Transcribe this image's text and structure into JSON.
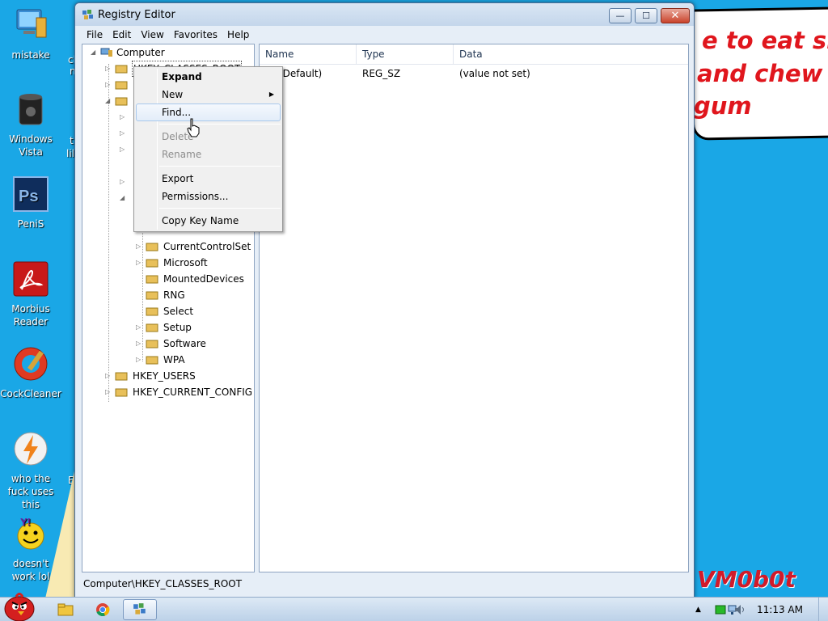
{
  "desktop": {
    "icons": [
      {
        "label": "mistake"
      },
      {
        "label": "Windows Vista"
      },
      {
        "label": "PeniS"
      },
      {
        "label": "Morbius Reader"
      },
      {
        "label": "CockCleaner"
      },
      {
        "label": "who the fuck uses this"
      },
      {
        "label": "doesn't work lol"
      }
    ],
    "partial_labels": [
      "cl",
      "n",
      "t",
      "lil",
      "E",
      "n"
    ],
    "wallpaper_text": [
      "e to eat shit",
      "and chew",
      "gum"
    ],
    "watermark": "VM0b0t"
  },
  "window": {
    "title": "Registry Editor",
    "menu": [
      "File",
      "Edit",
      "View",
      "Favorites",
      "Help"
    ],
    "controls": {
      "minimize": "—",
      "maximize": "☐",
      "close": "✕"
    }
  },
  "tree": {
    "root": "Computer",
    "hives_top": [
      "HKEY_CLASSES_ROOT"
    ],
    "system_children": [
      "CurrentControlSet",
      "Microsoft",
      "MountedDevices",
      "RNG",
      "Select",
      "Setup",
      "Software",
      "WPA"
    ],
    "hives_bottom": [
      "HKEY_USERS",
      "HKEY_CURRENT_CONFIG"
    ]
  },
  "list": {
    "columns": [
      "Name",
      "Type",
      "Data"
    ],
    "rows": [
      {
        "name": "(Default)",
        "type": "REG_SZ",
        "data": "(value not set)"
      }
    ]
  },
  "status_path": "Computer\\HKEY_CLASSES_ROOT",
  "context_menu": {
    "items": [
      {
        "label": "Expand",
        "style": "bold"
      },
      {
        "label": "New",
        "style": "submenu"
      },
      {
        "label": "Find...",
        "style": "hover"
      },
      {
        "label": "Delete",
        "style": "disabled"
      },
      {
        "label": "Rename",
        "style": "disabled"
      },
      {
        "label": "Export",
        "style": "normal"
      },
      {
        "label": "Permissions...",
        "style": "normal"
      },
      {
        "label": "Copy Key Name",
        "style": "normal"
      }
    ]
  },
  "taskbar": {
    "clock": "11:13 AM"
  },
  "colors": {
    "desktop": "#1aa7e6",
    "wallpaper_text": "#e0161d",
    "watermark": "#d11a2a"
  }
}
